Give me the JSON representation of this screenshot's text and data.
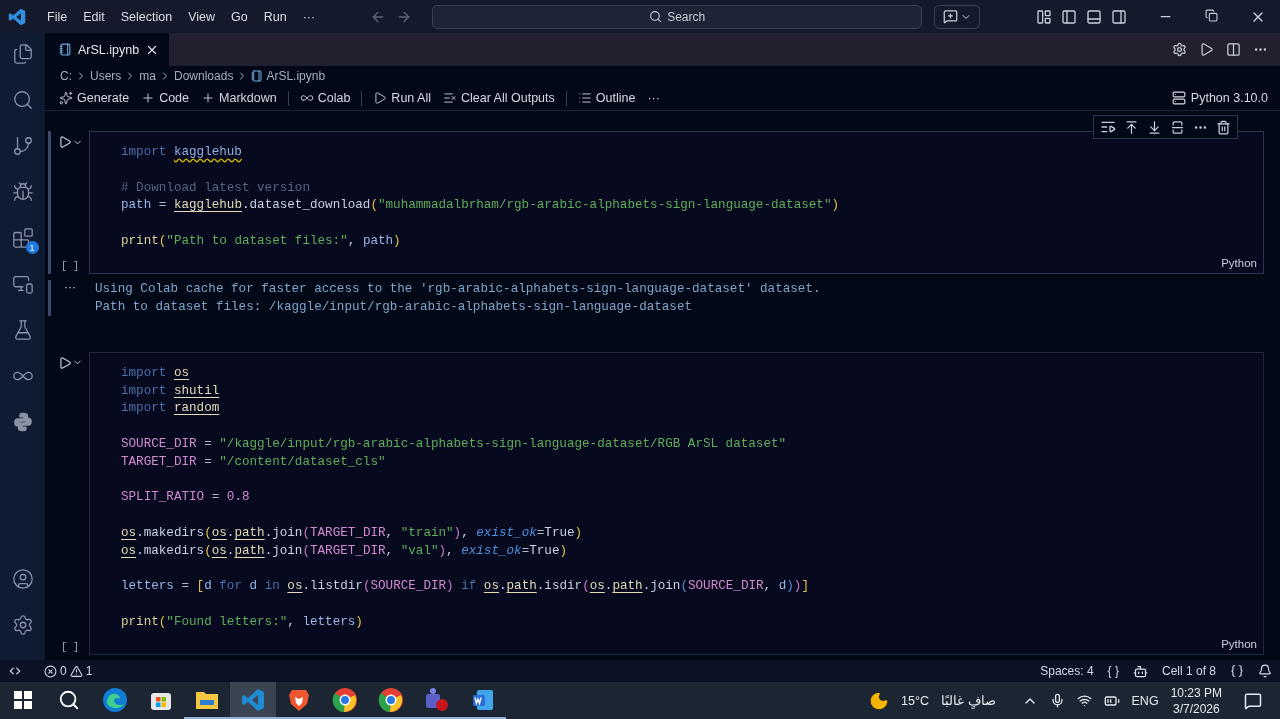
{
  "title_bar": {
    "menu": [
      "File",
      "Edit",
      "Selection",
      "View",
      "Go",
      "Run",
      "···"
    ],
    "search": {
      "placeholder": "Search"
    }
  },
  "activity_bar": {
    "items": [
      {
        "kind": "files"
      },
      {
        "kind": "search"
      },
      {
        "kind": "source-control"
      },
      {
        "kind": "run"
      },
      {
        "kind": "extensions",
        "badge": "1"
      },
      {
        "kind": "remote"
      },
      {
        "kind": "testing"
      },
      {
        "kind": "colab"
      },
      {
        "kind": "python"
      }
    ],
    "bottom": [
      {
        "kind": "account"
      },
      {
        "kind": "settings"
      }
    ]
  },
  "tabs": [
    {
      "label": "ArSL.ipynb",
      "selected": true
    }
  ],
  "breadcrumb": [
    "C:",
    "Users",
    "ma",
    "Downloads",
    "ArSL.ipynb"
  ],
  "toolbar": {
    "items": [
      {
        "kind": "generate",
        "label": "Generate"
      },
      {
        "kind": "add",
        "label": "Code"
      },
      {
        "kind": "add",
        "label": "Markdown"
      },
      {
        "kind": "colab",
        "label": "Colab"
      },
      {
        "kind": "run",
        "label": "Run All"
      },
      {
        "kind": "clear",
        "label": "Clear All Outputs"
      },
      {
        "kind": "outline",
        "label": "Outline"
      }
    ],
    "more": "···",
    "kernel": "Python 3.10.0"
  },
  "cells": [
    {
      "selected": true,
      "count": "[ ]",
      "language": "Python",
      "lines": [
        {
          "tokens": [
            {
              "kind": "kw",
              "text": "import "
            },
            {
              "kind": "modw",
              "text": "kagglehub"
            }
          ]
        },
        {
          "blank_before": true,
          "tokens": [
            {
              "kind": "cm",
              "text": "# Download latest version"
            }
          ]
        },
        {
          "tokens": [
            {
              "kind": "var",
              "text": "path"
            },
            {
              "kind": "op",
              "text": " = "
            },
            {
              "kind": "mod",
              "text": "kagglehub"
            },
            {
              "kind": "plain",
              "text": ".dataset_download"
            },
            {
              "kind": "br1",
              "text": "("
            },
            {
              "kind": "str",
              "text": "\"muhammadalbrham/rgb-arabic-alphabets-sign-language-dataset\""
            },
            {
              "kind": "br1",
              "text": ")"
            }
          ]
        },
        {
          "blank_before": true,
          "tokens": [
            {
              "kind": "fn",
              "text": "print"
            },
            {
              "kind": "br1",
              "text": "("
            },
            {
              "kind": "str",
              "text": "\"Path to dataset files:\""
            },
            {
              "kind": "plain",
              "text": ", "
            },
            {
              "kind": "var",
              "text": "path"
            },
            {
              "kind": "br1",
              "text": ")"
            }
          ]
        }
      ],
      "output": {
        "marker": "···",
        "lines": [
          "Using Colab cache for faster access to the 'rgb-arabic-alphabets-sign-language-dataset' dataset.",
          "Path to dataset files: /kaggle/input/rgb-arabic-alphabets-sign-language-dataset"
        ]
      }
    },
    {
      "selected": false,
      "count": "[ ]",
      "language": "Python",
      "lines": [
        {
          "tokens": [
            {
              "kind": "kw",
              "text": "import "
            },
            {
              "kind": "mod",
              "text": "os"
            }
          ]
        },
        {
          "tokens": [
            {
              "kind": "kw",
              "text": "import "
            },
            {
              "kind": "mod",
              "text": "shutil"
            }
          ]
        },
        {
          "tokens": [
            {
              "kind": "kw",
              "text": "import "
            },
            {
              "kind": "mod",
              "text": "random"
            }
          ]
        },
        {
          "blank_before": true,
          "tokens": [
            {
              "kind": "const",
              "text": "SOURCE_DIR"
            },
            {
              "kind": "op",
              "text": " = "
            },
            {
              "kind": "str",
              "text": "\"/kaggle/input/rgb-arabic-alphabets-sign-language-dataset/RGB ArSL dataset\""
            }
          ]
        },
        {
          "tokens": [
            {
              "kind": "const",
              "text": "TARGET_DIR"
            },
            {
              "kind": "op",
              "text": " = "
            },
            {
              "kind": "str",
              "text": "\"/content/dataset_cls\""
            }
          ]
        },
        {
          "blank_before": true,
          "tokens": [
            {
              "kind": "const",
              "text": "SPLIT_RATIO"
            },
            {
              "kind": "op",
              "text": " = "
            },
            {
              "kind": "num",
              "text": "0.8"
            }
          ]
        },
        {
          "blank_before": true,
          "tokens": [
            {
              "kind": "mod",
              "text": "os"
            },
            {
              "kind": "plain",
              "text": ".makedirs"
            },
            {
              "kind": "br1",
              "text": "("
            },
            {
              "kind": "mod",
              "text": "os"
            },
            {
              "kind": "plain",
              "text": "."
            },
            {
              "kind": "mod",
              "text": "path"
            },
            {
              "kind": "plain",
              "text": ".join"
            },
            {
              "kind": "br2",
              "text": "("
            },
            {
              "kind": "const",
              "text": "TARGET_DIR"
            },
            {
              "kind": "plain",
              "text": ", "
            },
            {
              "kind": "str",
              "text": "\"train\""
            },
            {
              "kind": "br2",
              "text": ")"
            },
            {
              "kind": "plain",
              "text": ", "
            },
            {
              "kind": "param",
              "text": "exist_ok"
            },
            {
              "kind": "op",
              "text": "="
            },
            {
              "kind": "bool",
              "text": "True"
            },
            {
              "kind": "br1",
              "text": ")"
            }
          ]
        },
        {
          "tokens": [
            {
              "kind": "mod",
              "text": "os"
            },
            {
              "kind": "plain",
              "text": ".makedirs"
            },
            {
              "kind": "br1",
              "text": "("
            },
            {
              "kind": "mod",
              "text": "os"
            },
            {
              "kind": "plain",
              "text": "."
            },
            {
              "kind": "mod",
              "text": "path"
            },
            {
              "kind": "plain",
              "text": ".join"
            },
            {
              "kind": "br2",
              "text": "("
            },
            {
              "kind": "const",
              "text": "TARGET_DIR"
            },
            {
              "kind": "plain",
              "text": ", "
            },
            {
              "kind": "str",
              "text": "\"val\""
            },
            {
              "kind": "br2",
              "text": ")"
            },
            {
              "kind": "plain",
              "text": ", "
            },
            {
              "kind": "param",
              "text": "exist_ok"
            },
            {
              "kind": "op",
              "text": "="
            },
            {
              "kind": "bool",
              "text": "True"
            },
            {
              "kind": "br1",
              "text": ")"
            }
          ]
        },
        {
          "blank_before": true,
          "tokens": [
            {
              "kind": "var",
              "text": "letters"
            },
            {
              "kind": "op",
              "text": " = "
            },
            {
              "kind": "br1",
              "text": "["
            },
            {
              "kind": "var",
              "text": "d "
            },
            {
              "kind": "kw",
              "text": "for "
            },
            {
              "kind": "var",
              "text": "d "
            },
            {
              "kind": "kw",
              "text": "in "
            },
            {
              "kind": "mod",
              "text": "os"
            },
            {
              "kind": "plain",
              "text": ".listdir"
            },
            {
              "kind": "br2",
              "text": "("
            },
            {
              "kind": "const",
              "text": "SOURCE_DIR"
            },
            {
              "kind": "br2",
              "text": ")"
            },
            {
              "kind": "kw",
              "text": " if "
            },
            {
              "kind": "mod",
              "text": "os"
            },
            {
              "kind": "plain",
              "text": "."
            },
            {
              "kind": "mod",
              "text": "path"
            },
            {
              "kind": "plain",
              "text": ".isdir"
            },
            {
              "kind": "br2",
              "text": "("
            },
            {
              "kind": "mod",
              "text": "os"
            },
            {
              "kind": "plain",
              "text": "."
            },
            {
              "kind": "mod",
              "text": "path"
            },
            {
              "kind": "plain",
              "text": ".join"
            },
            {
              "kind": "br3",
              "text": "("
            },
            {
              "kind": "const",
              "text": "SOURCE_DIR"
            },
            {
              "kind": "plain",
              "text": ", "
            },
            {
              "kind": "var",
              "text": "d"
            },
            {
              "kind": "br3",
              "text": ")"
            },
            {
              "kind": "br2",
              "text": ")"
            },
            {
              "kind": "br1",
              "text": "]"
            }
          ]
        },
        {
          "blank_before": true,
          "tokens": [
            {
              "kind": "fn",
              "text": "print"
            },
            {
              "kind": "br1",
              "text": "("
            },
            {
              "kind": "str",
              "text": "\"Found letters:\""
            },
            {
              "kind": "plain",
              "text": ", "
            },
            {
              "kind": "var",
              "text": "letters"
            },
            {
              "kind": "br1",
              "text": ")"
            }
          ]
        }
      ]
    }
  ],
  "status_bar": {
    "errors": "0",
    "warnings": "1",
    "spaces": "Spaces: 4",
    "braces": "{ }",
    "cell": "Cell 1 of 8"
  },
  "taskbar": {
    "apps": [
      {
        "kind": "edge",
        "running": false,
        "selected": false
      },
      {
        "kind": "store",
        "running": false,
        "selected": false
      },
      {
        "kind": "explorer",
        "running": true,
        "selected": false
      },
      {
        "kind": "vscode",
        "running": true,
        "selected": true
      },
      {
        "kind": "brave",
        "running": true,
        "selected": false
      },
      {
        "kind": "chrome",
        "running": true,
        "selected": false
      },
      {
        "kind": "chrome",
        "running": true,
        "selected": false
      },
      {
        "kind": "teams",
        "running": true,
        "selected": false
      },
      {
        "kind": "word",
        "running": true,
        "selected": false
      }
    ],
    "weather": {
      "temp": "15°C",
      "condition": "صافٍ غالبًا"
    },
    "language": "ENG",
    "time": "10:23 PM",
    "date": "3/7/2026"
  }
}
